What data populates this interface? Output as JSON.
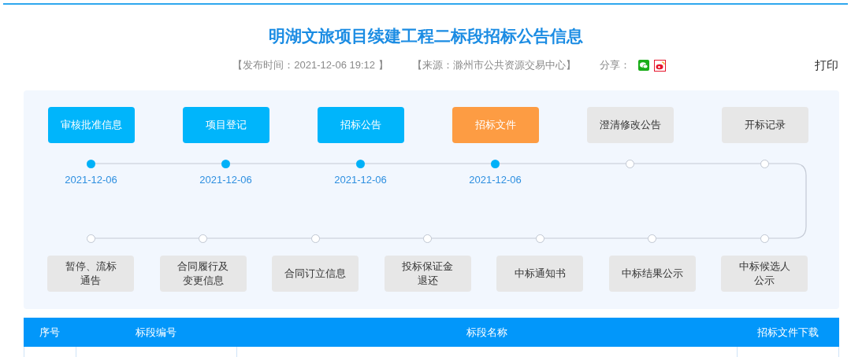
{
  "title": "明湖文旅项目续建工程二标段招标公告信息",
  "meta": {
    "publish_time": "【发布时间：2021-12-06 19:12 】",
    "source": "【来源：滁州市公共资源交易中心】",
    "share_label": "分享：",
    "print": "打印"
  },
  "steps_top": [
    {
      "label_lines": [
        "审核批准信息"
      ],
      "kind": "done",
      "date": "2021-12-06"
    },
    {
      "label_lines": [
        "项目登记"
      ],
      "kind": "done",
      "date": "2021-12-06"
    },
    {
      "label_lines": [
        "招标公告"
      ],
      "kind": "done",
      "date": "2021-12-06"
    },
    {
      "label_lines": [
        "招标文件"
      ],
      "kind": "current",
      "date": "2021-12-06"
    },
    {
      "label_lines": [
        "澄清修改公告"
      ],
      "kind": "pending"
    },
    {
      "label_lines": [
        "开标记录"
      ],
      "kind": "pending"
    }
  ],
  "steps_bottom": [
    {
      "label_lines": [
        "暂停、流标",
        "通告"
      ],
      "kind": "pending"
    },
    {
      "label_lines": [
        "合同履行及",
        "变更信息"
      ],
      "kind": "pending"
    },
    {
      "label_lines": [
        "合同订立信息"
      ],
      "kind": "pending"
    },
    {
      "label_lines": [
        "投标保证金",
        "退还"
      ],
      "kind": "pending"
    },
    {
      "label_lines": [
        "中标通知书"
      ],
      "kind": "pending"
    },
    {
      "label_lines": [
        "中标结果公示"
      ],
      "kind": "pending"
    },
    {
      "label_lines": [
        "中标候选人",
        "公示"
      ],
      "kind": "pending"
    }
  ],
  "table": {
    "columns": [
      "序号",
      "标段编号",
      "标段名称",
      "招标文件下载"
    ]
  }
}
